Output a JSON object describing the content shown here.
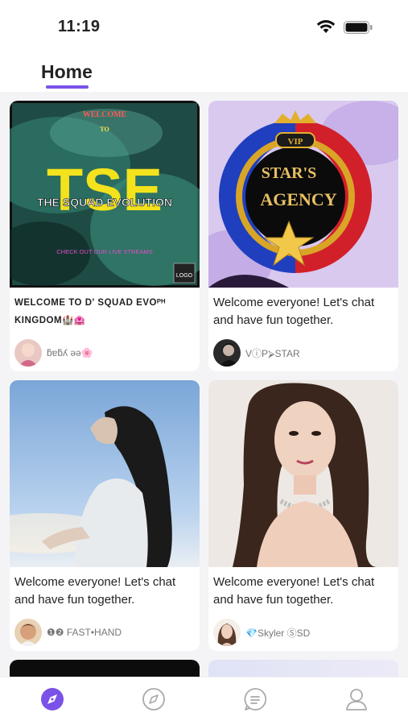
{
  "status": {
    "time": "11:19"
  },
  "header": {
    "tab_label": "Home"
  },
  "cards": [
    {
      "title": "WELCOME TO D' SQUAD EVOᴾᴴ KINGDOM🏰🏩",
      "author": "ƃɐƃʎ ǝǝ🌸",
      "image_text": {
        "top": "WELCOME",
        "mid": "TO",
        "logo": "TSE",
        "banner": "THE SQUAD EVOLUTION",
        "sub": "CHECK OUT OUR LIVE STREAMS",
        "badge": "LOGO"
      }
    },
    {
      "title": "Welcome everyone! Let's chat and have fun together.",
      "author": "VⓘP⮚STAR",
      "image_text": {
        "vip": "VIP",
        "line1": "STAR'S",
        "line2": "AGENCY"
      }
    },
    {
      "title": "Welcome everyone! Let's chat and have fun together.",
      "author": "❶❷ FAST•HAND"
    },
    {
      "title": "Welcome everyone! Let's chat and have fun together.",
      "author": "💎Skyler ⓈSD"
    }
  ],
  "colors": {
    "accent": "#7a52e8",
    "background": "#f4f4f6"
  },
  "tabbar": {
    "items": [
      "discover-icon",
      "compass-icon",
      "messages-icon",
      "profile-icon"
    ],
    "active": 0
  }
}
